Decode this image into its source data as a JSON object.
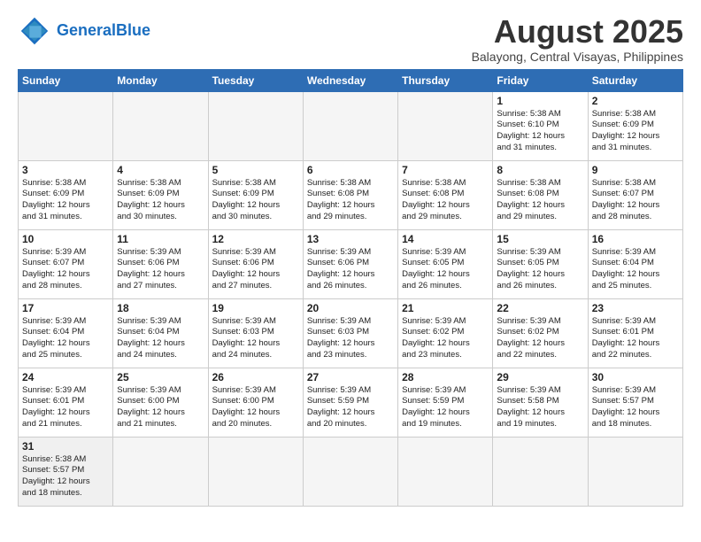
{
  "header": {
    "logo_general": "General",
    "logo_blue": "Blue",
    "title": "August 2025",
    "subtitle": "Balayong, Central Visayas, Philippines"
  },
  "weekdays": [
    "Sunday",
    "Monday",
    "Tuesday",
    "Wednesday",
    "Thursday",
    "Friday",
    "Saturday"
  ],
  "weeks": [
    [
      {
        "day": "",
        "info": ""
      },
      {
        "day": "",
        "info": ""
      },
      {
        "day": "",
        "info": ""
      },
      {
        "day": "",
        "info": ""
      },
      {
        "day": "",
        "info": ""
      },
      {
        "day": "1",
        "info": "Sunrise: 5:38 AM\nSunset: 6:10 PM\nDaylight: 12 hours\nand 31 minutes."
      },
      {
        "day": "2",
        "info": "Sunrise: 5:38 AM\nSunset: 6:09 PM\nDaylight: 12 hours\nand 31 minutes."
      }
    ],
    [
      {
        "day": "3",
        "info": "Sunrise: 5:38 AM\nSunset: 6:09 PM\nDaylight: 12 hours\nand 31 minutes."
      },
      {
        "day": "4",
        "info": "Sunrise: 5:38 AM\nSunset: 6:09 PM\nDaylight: 12 hours\nand 30 minutes."
      },
      {
        "day": "5",
        "info": "Sunrise: 5:38 AM\nSunset: 6:09 PM\nDaylight: 12 hours\nand 30 minutes."
      },
      {
        "day": "6",
        "info": "Sunrise: 5:38 AM\nSunset: 6:08 PM\nDaylight: 12 hours\nand 29 minutes."
      },
      {
        "day": "7",
        "info": "Sunrise: 5:38 AM\nSunset: 6:08 PM\nDaylight: 12 hours\nand 29 minutes."
      },
      {
        "day": "8",
        "info": "Sunrise: 5:38 AM\nSunset: 6:08 PM\nDaylight: 12 hours\nand 29 minutes."
      },
      {
        "day": "9",
        "info": "Sunrise: 5:38 AM\nSunset: 6:07 PM\nDaylight: 12 hours\nand 28 minutes."
      }
    ],
    [
      {
        "day": "10",
        "info": "Sunrise: 5:39 AM\nSunset: 6:07 PM\nDaylight: 12 hours\nand 28 minutes."
      },
      {
        "day": "11",
        "info": "Sunrise: 5:39 AM\nSunset: 6:06 PM\nDaylight: 12 hours\nand 27 minutes."
      },
      {
        "day": "12",
        "info": "Sunrise: 5:39 AM\nSunset: 6:06 PM\nDaylight: 12 hours\nand 27 minutes."
      },
      {
        "day": "13",
        "info": "Sunrise: 5:39 AM\nSunset: 6:06 PM\nDaylight: 12 hours\nand 26 minutes."
      },
      {
        "day": "14",
        "info": "Sunrise: 5:39 AM\nSunset: 6:05 PM\nDaylight: 12 hours\nand 26 minutes."
      },
      {
        "day": "15",
        "info": "Sunrise: 5:39 AM\nSunset: 6:05 PM\nDaylight: 12 hours\nand 26 minutes."
      },
      {
        "day": "16",
        "info": "Sunrise: 5:39 AM\nSunset: 6:04 PM\nDaylight: 12 hours\nand 25 minutes."
      }
    ],
    [
      {
        "day": "17",
        "info": "Sunrise: 5:39 AM\nSunset: 6:04 PM\nDaylight: 12 hours\nand 25 minutes."
      },
      {
        "day": "18",
        "info": "Sunrise: 5:39 AM\nSunset: 6:04 PM\nDaylight: 12 hours\nand 24 minutes."
      },
      {
        "day": "19",
        "info": "Sunrise: 5:39 AM\nSunset: 6:03 PM\nDaylight: 12 hours\nand 24 minutes."
      },
      {
        "day": "20",
        "info": "Sunrise: 5:39 AM\nSunset: 6:03 PM\nDaylight: 12 hours\nand 23 minutes."
      },
      {
        "day": "21",
        "info": "Sunrise: 5:39 AM\nSunset: 6:02 PM\nDaylight: 12 hours\nand 23 minutes."
      },
      {
        "day": "22",
        "info": "Sunrise: 5:39 AM\nSunset: 6:02 PM\nDaylight: 12 hours\nand 22 minutes."
      },
      {
        "day": "23",
        "info": "Sunrise: 5:39 AM\nSunset: 6:01 PM\nDaylight: 12 hours\nand 22 minutes."
      }
    ],
    [
      {
        "day": "24",
        "info": "Sunrise: 5:39 AM\nSunset: 6:01 PM\nDaylight: 12 hours\nand 21 minutes."
      },
      {
        "day": "25",
        "info": "Sunrise: 5:39 AM\nSunset: 6:00 PM\nDaylight: 12 hours\nand 21 minutes."
      },
      {
        "day": "26",
        "info": "Sunrise: 5:39 AM\nSunset: 6:00 PM\nDaylight: 12 hours\nand 20 minutes."
      },
      {
        "day": "27",
        "info": "Sunrise: 5:39 AM\nSunset: 5:59 PM\nDaylight: 12 hours\nand 20 minutes."
      },
      {
        "day": "28",
        "info": "Sunrise: 5:39 AM\nSunset: 5:59 PM\nDaylight: 12 hours\nand 19 minutes."
      },
      {
        "day": "29",
        "info": "Sunrise: 5:39 AM\nSunset: 5:58 PM\nDaylight: 12 hours\nand 19 minutes."
      },
      {
        "day": "30",
        "info": "Sunrise: 5:39 AM\nSunset: 5:57 PM\nDaylight: 12 hours\nand 18 minutes."
      }
    ],
    [
      {
        "day": "31",
        "info": "Sunrise: 5:38 AM\nSunset: 5:57 PM\nDaylight: 12 hours\nand 18 minutes."
      },
      {
        "day": "",
        "info": ""
      },
      {
        "day": "",
        "info": ""
      },
      {
        "day": "",
        "info": ""
      },
      {
        "day": "",
        "info": ""
      },
      {
        "day": "",
        "info": ""
      },
      {
        "day": "",
        "info": ""
      }
    ]
  ]
}
